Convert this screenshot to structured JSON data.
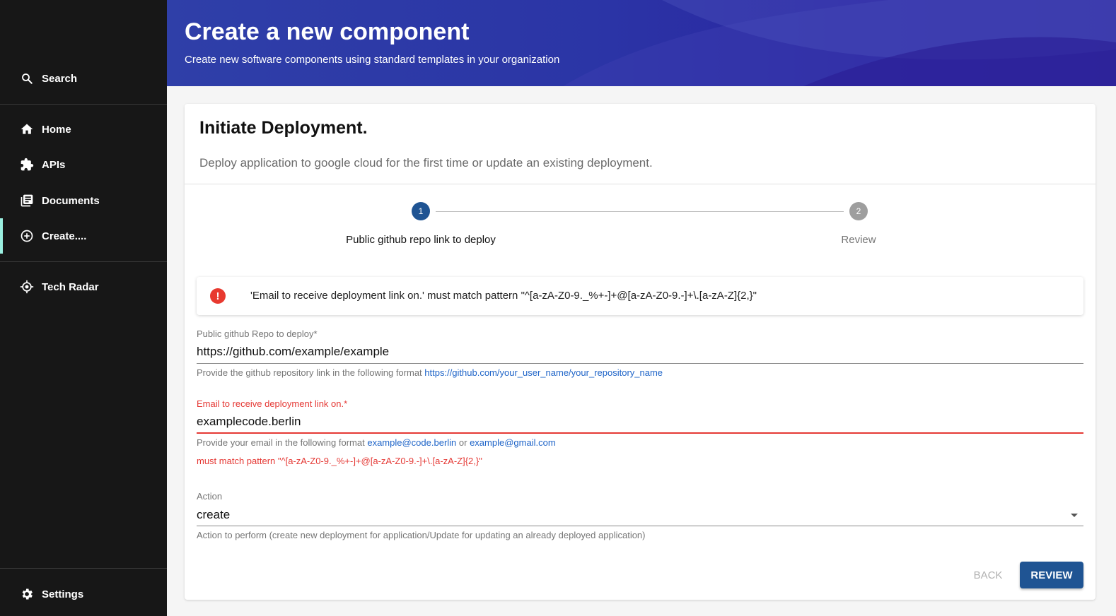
{
  "sidebar": {
    "search_label": "Search",
    "items": [
      {
        "label": "Home",
        "icon": "home-icon"
      },
      {
        "label": "APIs",
        "icon": "puzzle-icon"
      },
      {
        "label": "Documents",
        "icon": "library-books-icon"
      },
      {
        "label": "Create....",
        "icon": "add-circle-icon"
      }
    ],
    "tech_radar_label": "Tech Radar",
    "settings_label": "Settings",
    "accent": "#9bf0e1"
  },
  "header": {
    "title": "Create a new component",
    "subtitle": "Create new software components using standard templates in your organization"
  },
  "card": {
    "title": "Initiate Deployment.",
    "description": "Deploy application to google cloud for the first time or update an existing deployment."
  },
  "stepper": {
    "steps": [
      {
        "number": "1",
        "label": "Public github repo link to deploy",
        "active": true
      },
      {
        "number": "2",
        "label": "Review",
        "active": false
      }
    ]
  },
  "error": {
    "message": "'Email to receive deployment link on.' must match pattern \"^[a-zA-Z0-9._%+-]+@[a-zA-Z0-9.-]+\\.[a-zA-Z]{2,}\""
  },
  "fields": {
    "repo": {
      "label": "Public github Repo to deploy*",
      "value": "https://github.com/example/example",
      "helper_prefix": "Provide the github repository link in the following format ",
      "helper_link": "https://github.com/your_user_name/your_repository_name"
    },
    "email": {
      "label": "Email to receive deployment link on.*",
      "value": "examplecode.berlin",
      "helper_prefix": "Provide your email in the following format ",
      "helper_link1": "example@code.berlin",
      "helper_mid": " or ",
      "helper_link2": "example@gmail.com",
      "error": "must match pattern \"^[a-zA-Z0-9._%+-]+@[a-zA-Z0-9.-]+\\.[a-zA-Z]{2,}\""
    },
    "action": {
      "label": "Action",
      "value": "create",
      "helper": "Action to perform (create new deployment for application/Update for updating an already deployed application)"
    }
  },
  "buttons": {
    "back": "BACK",
    "review": "REVIEW"
  },
  "colors": {
    "primary": "#1f5493",
    "error": "#e53935",
    "step_active": "#1f5493",
    "step_inactive": "#9e9e9e"
  }
}
